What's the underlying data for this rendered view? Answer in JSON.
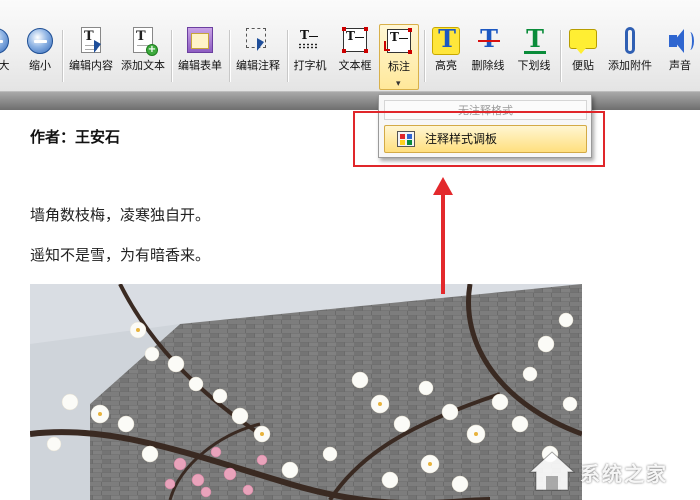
{
  "toolbar": {
    "buttons": [
      {
        "label": "大",
        "icon": "zoom-in-icon"
      },
      {
        "label": "缩小",
        "icon": "zoom-out-icon"
      },
      {
        "label": "编辑内容",
        "icon": "edit-content-icon"
      },
      {
        "label": "添加文本",
        "icon": "add-text-icon"
      },
      {
        "label": "编辑表单",
        "icon": "edit-form-icon"
      },
      {
        "label": "编辑注释",
        "icon": "edit-annotation-icon"
      },
      {
        "label": "打字机",
        "icon": "typewriter-icon"
      },
      {
        "label": "文本框",
        "icon": "textbox-icon"
      },
      {
        "label": "标注",
        "icon": "callout-icon"
      },
      {
        "label": "高亮",
        "icon": "highlight-icon"
      },
      {
        "label": "删除线",
        "icon": "strikethrough-icon"
      },
      {
        "label": "下划线",
        "icon": "underline-icon"
      },
      {
        "label": "便贴",
        "icon": "sticky-note-icon"
      },
      {
        "label": "添加附件",
        "icon": "attachment-icon"
      },
      {
        "label": "声音",
        "icon": "sound-icon"
      }
    ],
    "active": "标注",
    "more_glyph": "▾"
  },
  "dropdown": {
    "items": [
      {
        "label": "无注释格式",
        "enabled": false
      },
      {
        "label": "注释样式调板",
        "enabled": true,
        "icon": "palette-icon"
      }
    ]
  },
  "document": {
    "author": "作者：王安石",
    "lines": [
      "墙角数枝梅，凌寒独自开。",
      "遥知不是雪，为有暗香来。"
    ]
  },
  "watermark": {
    "text": "系统之家"
  },
  "colors": {
    "annotation_red": "#e0262a",
    "active_button": "#ffe89a",
    "highlight_yellow": "#ffe63b",
    "strike_red": "#d81010",
    "underline_green": "#0a8c3a"
  }
}
